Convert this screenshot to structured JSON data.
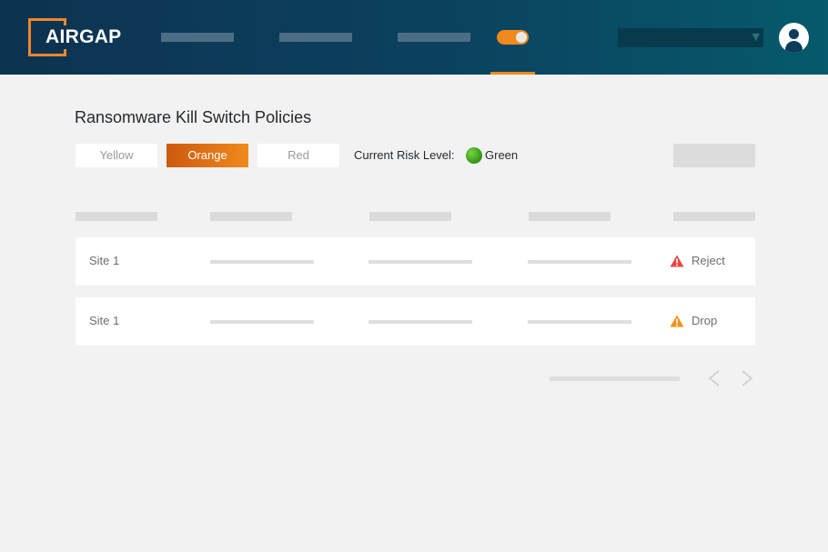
{
  "header": {
    "logo_text": "AIRGAP",
    "brand_color": "#f0862d",
    "toggle": {
      "state": "on",
      "color": "#f08a1c"
    }
  },
  "page": {
    "title": "Ransomware Kill Switch Policies"
  },
  "risk_buttons": [
    {
      "label": "Yellow",
      "active": false
    },
    {
      "label": "Orange",
      "active": true
    },
    {
      "label": "Red",
      "active": false
    }
  ],
  "risk": {
    "label": "Current Risk Level:",
    "value": "Green",
    "color": "#3da31c"
  },
  "table": {
    "rows": [
      {
        "site": "Site 1",
        "action": "Reject",
        "action_icon": "warning-triangle-icon",
        "action_color": "#e94545"
      },
      {
        "site": "Site 1",
        "action": "Drop",
        "action_icon": "warning-triangle-icon",
        "action_color": "#f0931c"
      }
    ]
  },
  "pagination": {
    "prev_icon": "chevron-left-icon",
    "next_icon": "chevron-right-icon"
  }
}
